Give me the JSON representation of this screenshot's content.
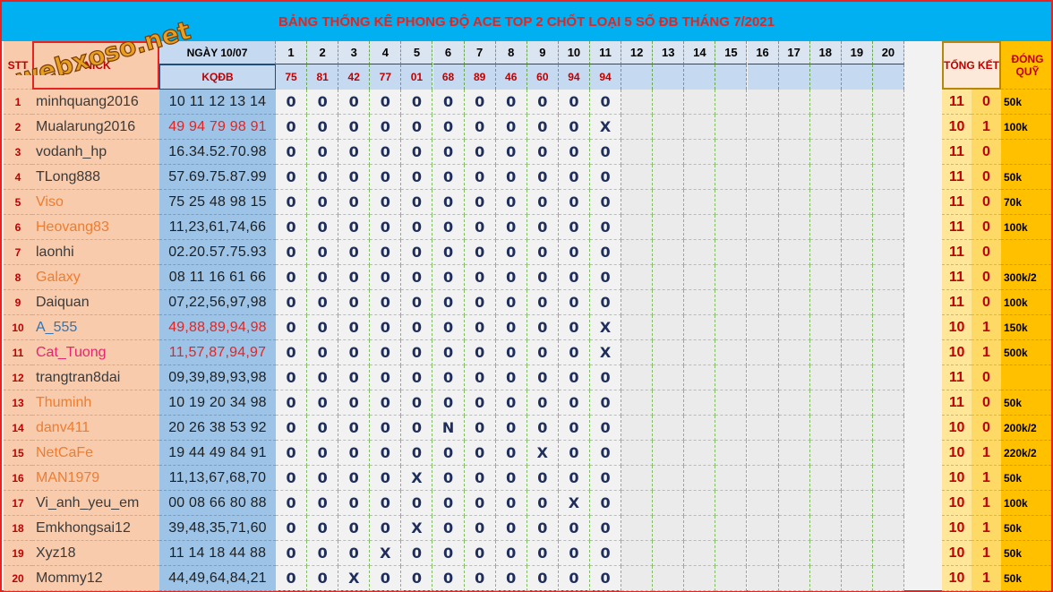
{
  "title": "BẢNG THỐNG KÊ PHONG ĐỘ ACE TOP 2 CHỐT LOẠI 5 SỐ ĐB THÁNG 7/2021",
  "watermark": "webxoso.net",
  "headers": {
    "stt": "STT",
    "nick": "NICK",
    "ngay": "NGÀY 10/07",
    "kqdb": "KQĐB",
    "tong_ket": "TỔNG KẾT",
    "dong_quy": "ĐÓNG QUỸ"
  },
  "days": [
    "1",
    "2",
    "3",
    "4",
    "5",
    "6",
    "7",
    "8",
    "9",
    "10",
    "11",
    "12",
    "13",
    "14",
    "15",
    "16",
    "17",
    "18",
    "19",
    "20"
  ],
  "results": [
    "75",
    "81",
    "42",
    "77",
    "01",
    "68",
    "89",
    "46",
    "60",
    "94",
    "94",
    "",
    "",
    "",
    "",
    "",
    "",
    "",
    "",
    ""
  ],
  "colors": {
    "title_bg": "#00b0f0",
    "title_text": "#e8231f",
    "nick_bg": "#f8cbad",
    "kq_bg": "#9dc3e6",
    "tong_bg": "#ffe699",
    "quy_bg": "#ffc000"
  },
  "rows": [
    {
      "stt": "1",
      "nick": "minhquang2016",
      "nick_color": "#3a3a3a",
      "kq": "10 11 12 13 14",
      "kq_color": "#1f1f1f",
      "marks": [
        "0",
        "0",
        "0",
        "0",
        "0",
        "0",
        "0",
        "0",
        "0",
        "0",
        "0"
      ],
      "tk1": "11",
      "tk2": "0",
      "quy": "50k"
    },
    {
      "stt": "2",
      "nick": "Mualarung2016",
      "nick_color": "#3a3a3a",
      "kq": "49 94 79 98 91",
      "kq_color": "#e8231f",
      "marks": [
        "0",
        "0",
        "0",
        "0",
        "0",
        "0",
        "0",
        "0",
        "0",
        "0",
        "X"
      ],
      "tk1": "10",
      "tk2": "1",
      "quy": "100k"
    },
    {
      "stt": "3",
      "nick": "vodanh_hp",
      "nick_color": "#3a3a3a",
      "kq": "16.34.52.70.98",
      "kq_color": "#1f1f1f",
      "marks": [
        "0",
        "0",
        "0",
        "0",
        "0",
        "0",
        "0",
        "0",
        "0",
        "0",
        "0"
      ],
      "tk1": "11",
      "tk2": "0",
      "quy": ""
    },
    {
      "stt": "4",
      "nick": "TLong888",
      "nick_color": "#3a3a3a",
      "kq": "57.69.75.87.99",
      "kq_color": "#1f1f1f",
      "marks": [
        "0",
        "0",
        "0",
        "0",
        "0",
        "0",
        "0",
        "0",
        "0",
        "0",
        "0"
      ],
      "tk1": "11",
      "tk2": "0",
      "quy": "50k"
    },
    {
      "stt": "5",
      "nick": "Viso",
      "nick_color": "#ed7d31",
      "kq": "75 25 48 98 15",
      "kq_color": "#1f1f1f",
      "marks": [
        "0",
        "0",
        "0",
        "0",
        "0",
        "0",
        "0",
        "0",
        "0",
        "0",
        "0"
      ],
      "tk1": "11",
      "tk2": "0",
      "quy": "70k"
    },
    {
      "stt": "6",
      "nick": "Heovang83",
      "nick_color": "#ed7d31",
      "kq": "11,23,61,74,66",
      "kq_color": "#1f1f1f",
      "marks": [
        "0",
        "0",
        "0",
        "0",
        "0",
        "0",
        "0",
        "0",
        "0",
        "0",
        "0"
      ],
      "tk1": "11",
      "tk2": "0",
      "quy": "100k"
    },
    {
      "stt": "7",
      "nick": "laonhi",
      "nick_color": "#3a3a3a",
      "kq": "02.20.57.75.93",
      "kq_color": "#1f1f1f",
      "marks": [
        "0",
        "0",
        "0",
        "0",
        "0",
        "0",
        "0",
        "0",
        "0",
        "0",
        "0"
      ],
      "tk1": "11",
      "tk2": "0",
      "quy": ""
    },
    {
      "stt": "8",
      "nick": "Galaxy",
      "nick_color": "#ed7d31",
      "kq": "08 11 16 61 66",
      "kq_color": "#1f1f1f",
      "marks": [
        "0",
        "0",
        "0",
        "0",
        "0",
        "0",
        "0",
        "0",
        "0",
        "0",
        "0"
      ],
      "tk1": "11",
      "tk2": "0",
      "quy": "300k/2"
    },
    {
      "stt": "9",
      "nick": "Daiquan",
      "nick_color": "#3a3a3a",
      "kq": "07,22,56,97,98",
      "kq_color": "#1f1f1f",
      "marks": [
        "0",
        "0",
        "0",
        "0",
        "0",
        "0",
        "0",
        "0",
        "0",
        "0",
        "0"
      ],
      "tk1": "11",
      "tk2": "0",
      "quy": "100k"
    },
    {
      "stt": "10",
      "nick": "A_555",
      "nick_color": "#2e75b6",
      "kq": "49,88,89,94,98",
      "kq_color": "#e8231f",
      "marks": [
        "0",
        "0",
        "0",
        "0",
        "0",
        "0",
        "0",
        "0",
        "0",
        "0",
        "X"
      ],
      "tk1": "10",
      "tk2": "1",
      "quy": "150k"
    },
    {
      "stt": "11",
      "nick": "Cat_Tuong",
      "nick_color": "#e8236f",
      "kq": "11,57,87,94,97",
      "kq_color": "#e8231f",
      "marks": [
        "0",
        "0",
        "0",
        "0",
        "0",
        "0",
        "0",
        "0",
        "0",
        "0",
        "X"
      ],
      "tk1": "10",
      "tk2": "1",
      "quy": "500k"
    },
    {
      "stt": "12",
      "nick": "trangtran8dai",
      "nick_color": "#3a3a3a",
      "kq": "09,39,89,93,98",
      "kq_color": "#1f1f1f",
      "marks": [
        "0",
        "0",
        "0",
        "0",
        "0",
        "0",
        "0",
        "0",
        "0",
        "0",
        "0"
      ],
      "tk1": "11",
      "tk2": "0",
      "quy": ""
    },
    {
      "stt": "13",
      "nick": "Thuminh",
      "nick_color": "#ed7d31",
      "kq": "10 19 20 34 98",
      "kq_color": "#1f1f1f",
      "marks": [
        "0",
        "0",
        "0",
        "0",
        "0",
        "0",
        "0",
        "0",
        "0",
        "0",
        "0"
      ],
      "tk1": "11",
      "tk2": "0",
      "quy": "50k"
    },
    {
      "stt": "14",
      "nick": "danv411",
      "nick_color": "#ed7d31",
      "kq": "20 26 38 53 92",
      "kq_color": "#1f1f1f",
      "marks": [
        "0",
        "0",
        "0",
        "0",
        "0",
        "N",
        "0",
        "0",
        "0",
        "0",
        "0"
      ],
      "tk1": "10",
      "tk2": "0",
      "quy": "200k/2"
    },
    {
      "stt": "15",
      "nick": "NetCaFe",
      "nick_color": "#ed7d31",
      "kq": "19 44 49 84 91",
      "kq_color": "#1f1f1f",
      "marks": [
        "0",
        "0",
        "0",
        "0",
        "0",
        "0",
        "0",
        "0",
        "X",
        "0",
        "0"
      ],
      "tk1": "10",
      "tk2": "1",
      "quy": "220k/2"
    },
    {
      "stt": "16",
      "nick": "MAN1979",
      "nick_color": "#ed7d31",
      "kq": "11,13,67,68,70",
      "kq_color": "#1f1f1f",
      "marks": [
        "0",
        "0",
        "0",
        "0",
        "X",
        "0",
        "0",
        "0",
        "0",
        "0",
        "0"
      ],
      "tk1": "10",
      "tk2": "1",
      "quy": "50k"
    },
    {
      "stt": "17",
      "nick": "Vi_anh_yeu_em",
      "nick_color": "#3a3a3a",
      "kq": "00 08 66 80 88",
      "kq_color": "#1f1f1f",
      "marks": [
        "0",
        "0",
        "0",
        "0",
        "0",
        "0",
        "0",
        "0",
        "0",
        "X",
        "0"
      ],
      "tk1": "10",
      "tk2": "1",
      "quy": "100k"
    },
    {
      "stt": "18",
      "nick": "Emkhongsai12",
      "nick_color": "#3a3a3a",
      "kq": "39,48,35,71,60",
      "kq_color": "#1f1f1f",
      "marks": [
        "0",
        "0",
        "0",
        "0",
        "X",
        "0",
        "0",
        "0",
        "0",
        "0",
        "0"
      ],
      "tk1": "10",
      "tk2": "1",
      "quy": "50k"
    },
    {
      "stt": "19",
      "nick": "Xyz18",
      "nick_color": "#3a3a3a",
      "kq": "11 14 18 44 88",
      "kq_color": "#1f1f1f",
      "marks": [
        "0",
        "0",
        "0",
        "X",
        "0",
        "0",
        "0",
        "0",
        "0",
        "0",
        "0"
      ],
      "tk1": "10",
      "tk2": "1",
      "quy": "50k"
    },
    {
      "stt": "20",
      "nick": "Mommy12",
      "nick_color": "#3a3a3a",
      "kq": "44,49,64,84,21",
      "kq_color": "#1f1f1f",
      "marks": [
        "0",
        "0",
        "X",
        "0",
        "0",
        "0",
        "0",
        "0",
        "0",
        "0",
        "0"
      ],
      "tk1": "10",
      "tk2": "1",
      "quy": "50k"
    }
  ]
}
